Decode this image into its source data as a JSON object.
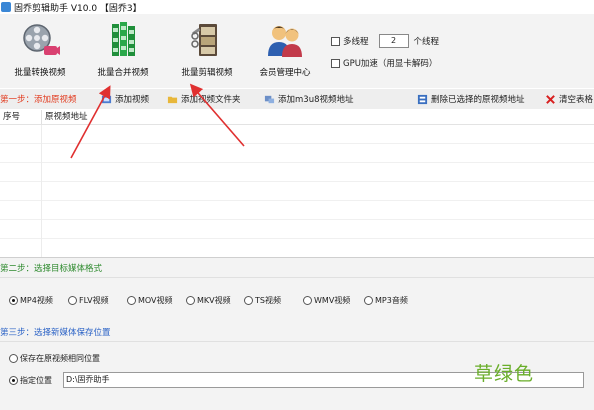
{
  "window": {
    "title": "固乔剪辑助手 V10.0 【固乔3】"
  },
  "toolbar": {
    "items": [
      {
        "label": "批量转换视频",
        "icon": "film-reel-icon"
      },
      {
        "label": "批量合并视频",
        "icon": "merge-grid-icon"
      },
      {
        "label": "批量剪辑视频",
        "icon": "film-clapper-icon"
      },
      {
        "label": "会员管理中心",
        "icon": "users-icon"
      }
    ],
    "multithread_label": "多线程",
    "thread_count": "2",
    "thread_unit": "个线程",
    "gpu_label": "GPU加速（用显卡解码）"
  },
  "step1": {
    "title": "第一步：添加原视频",
    "actions": [
      {
        "label": "添加视频",
        "icon": "add-video-icon"
      },
      {
        "label": "添加视频文件夹",
        "icon": "folder-icon"
      },
      {
        "label": "添加m3u8视频地址",
        "icon": "link-icon"
      },
      {
        "label": "删除已选择的原视频地址",
        "icon": "delete-icon"
      },
      {
        "label": "清空表格",
        "icon": "clear-icon"
      }
    ]
  },
  "grid": {
    "columns": [
      "序号",
      "原视频地址"
    ]
  },
  "step2": {
    "title": "第二步：选择目标媒体格式",
    "formats": [
      "MP4视频",
      "FLV视频",
      "MOV视频",
      "MKV视频",
      "TS视频",
      "WMV视频",
      "MP3音频"
    ],
    "selected": "MP4视频"
  },
  "step3": {
    "title": "第三步：选择新媒体保存位置",
    "option_same": "保存在原视频相同位置",
    "option_custom": "指定位置",
    "path": "D:\\固乔助手"
  },
  "overlay": {
    "text": "草绿色"
  },
  "colors": {
    "arrow": "#e03030",
    "step1": "#e23b1f",
    "step2": "#2d8a2d",
    "step3": "#2a62c6",
    "overlay": "#6aae2a"
  }
}
